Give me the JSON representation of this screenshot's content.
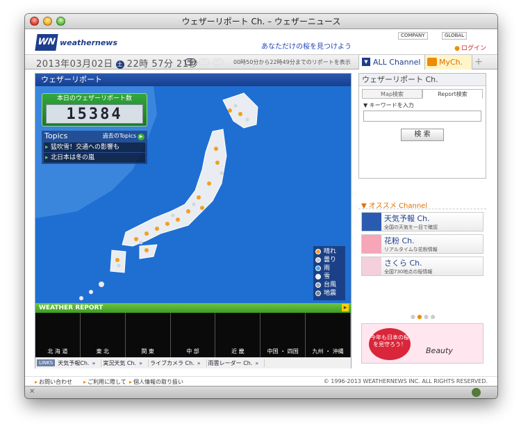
{
  "window": {
    "title": "ウェザーリポート Ch. – ウェザーニュース"
  },
  "header": {
    "logo_mark": "WN",
    "logo_text": "weathernews",
    "tagline": "あなただけの桜を見つけよう",
    "company": "COMPANY",
    "global": "GLOBAL",
    "login": "ログイン"
  },
  "toolbar": {
    "date": "2013年03月02日",
    "day": "土",
    "time": "22時 57分 21秒",
    "m1": "M1",
    "m2": "M2",
    "m3": "M3",
    "range": "00時50分から22時49分までのリポートを表示",
    "all_channel": "ALL Channel",
    "my_channel": "MyCh.",
    "add": "+"
  },
  "main": {
    "title": "ウェザーリポート",
    "counter_label": "本日のウェザーリポート数",
    "counter_value": "15384",
    "topics_title": "Topics",
    "topics_more": "過去のTopics",
    "topics": [
      "猛吹雪！交通への影響も",
      "北日本は冬の嵐"
    ],
    "legend": [
      {
        "label": "晴れ",
        "color": "#f0a020"
      },
      {
        "label": "曇り",
        "color": "#c8c8c8"
      },
      {
        "label": "雨",
        "color": "#3fa7e8"
      },
      {
        "label": "雪",
        "color": "#e8f2fa"
      },
      {
        "label": "台風",
        "color": "#9ab"
      },
      {
        "label": "地震",
        "color": "#789"
      }
    ],
    "weather_report_label": "WEATHER REPORT",
    "regions": [
      "北 海 道",
      "東 北",
      "関 東",
      "中 部",
      "近 畿",
      "中国 ・ 四国",
      "九州 ・ 沖縄"
    ],
    "links_label": "LINKS",
    "links": [
      "天気予報Ch.",
      "実況天気 Ch.",
      "ライブカメラ Ch.",
      "雨雲レーダー Ch."
    ]
  },
  "side": {
    "title": "ウェザーリポート Ch.",
    "tab_map": "Map検索",
    "tab_report": "Report検索",
    "keyword_label": "▼ キーワードを入力",
    "search_button": "検 索",
    "osusume_title": "▼ オススメ Channel",
    "channels": [
      {
        "name": "天気予報 Ch.",
        "desc": "全国の天気を一目で確認"
      },
      {
        "name": "花粉 Ch.",
        "desc": "リアルタイムな花粉情報"
      },
      {
        "name": "さくら Ch.",
        "desc": "全国730地点の桜情報"
      }
    ],
    "banner_text": "今年も日本の桜を見守ろう！",
    "banner_brand": "Beauty"
  },
  "footer": {
    "contact": "お問い合わせ",
    "terms": "ご利用に際して",
    "privacy": "個人情報の取り扱い",
    "copyright": "© 1996-2013 WEATHERNEWS INC. ALL RIGHTS RESERVED."
  }
}
